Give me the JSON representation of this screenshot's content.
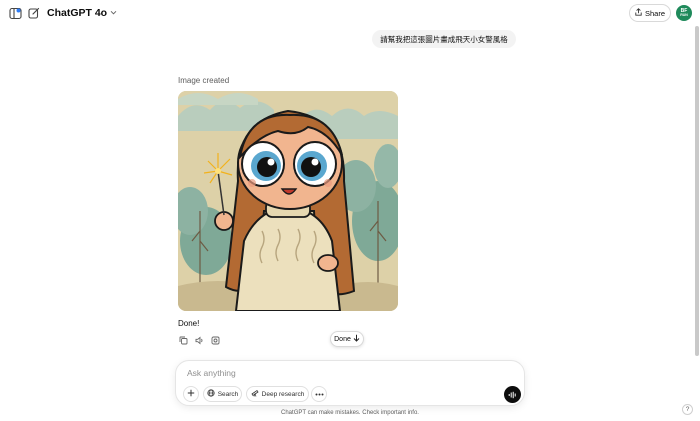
{
  "header": {
    "model_name": "ChatGPT 4o",
    "share_label": "Share",
    "avatar_initials_top": "BF",
    "avatar_initials_bottom": "RUN"
  },
  "conversation": {
    "user_message": "請幫我把這張圖片畫成飛天小女警風格",
    "image_created_label": "Image created",
    "assistant_text": "Done!"
  },
  "scroll_button": {
    "label": "Done"
  },
  "composer": {
    "placeholder": "Ask anything",
    "search_label": "Search",
    "deep_research_label": "Deep research"
  },
  "footer": {
    "disclaimer": "ChatGPT can make mistakes. Check important info.",
    "help_label": "?"
  },
  "colors": {
    "avatar": "#1f8a5b",
    "voice_button": "#0d0d0d",
    "image_background": "#ddd0a9"
  }
}
